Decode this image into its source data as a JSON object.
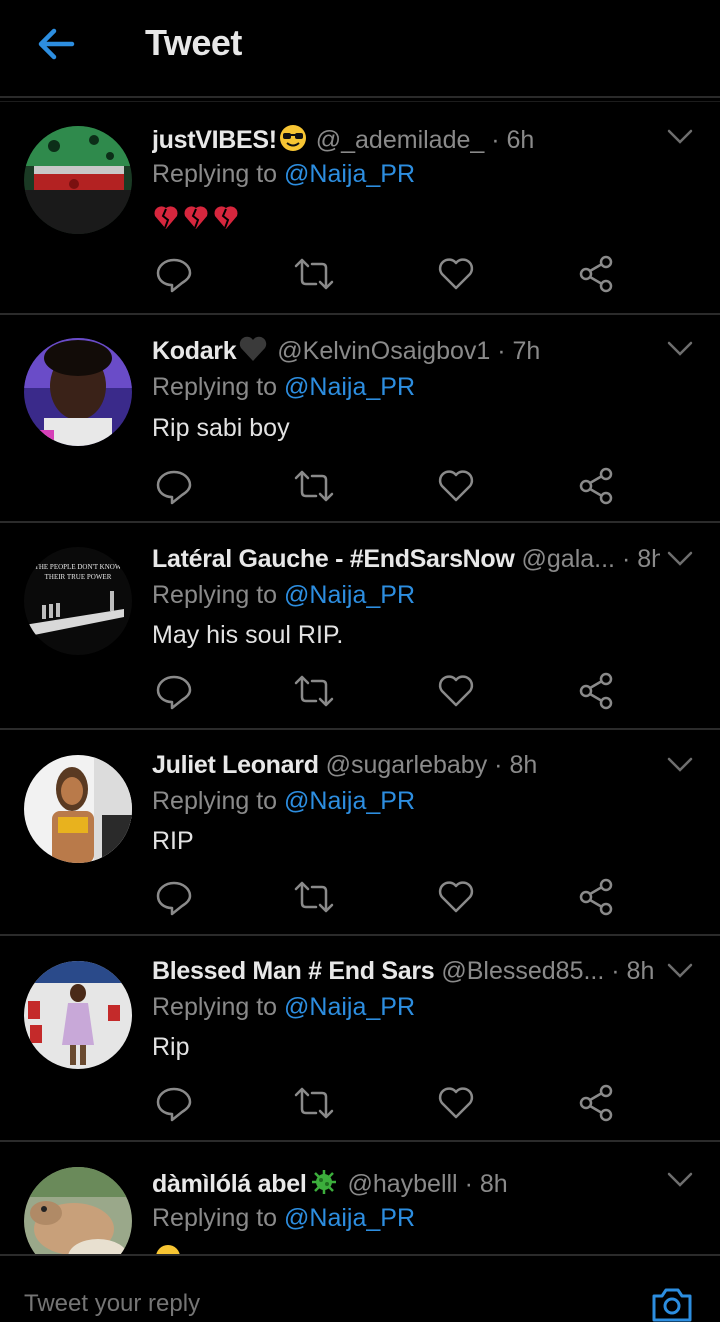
{
  "header": {
    "title": "Tweet"
  },
  "tweets": [
    {
      "name": "justVIBES!",
      "name_emoji": "sunglasses-emoji",
      "handle": "@_ademilade_",
      "time": "· 6h",
      "replying_prefix": "Replying to ",
      "replying_to": "@Naija_PR",
      "text": "",
      "body_emoji": "broken-heart-emoji x3"
    },
    {
      "name": "Kodark",
      "name_emoji": "black-heart-emoji",
      "handle": "@KelvinOsaigbov1",
      "time": "· 7h",
      "replying_prefix": "Replying to ",
      "replying_to": "@Naija_PR",
      "text": "Rip sabi boy"
    },
    {
      "name": "Latéral Gauche - #EndSarsNow",
      "handle": "@gala...",
      "time": "· 8h",
      "replying_prefix": "Replying to ",
      "replying_to": "@Naija_PR",
      "text": "May his soul RIP.",
      "avatar_text_1": "THE PEOPLE DON'T KNOW",
      "avatar_text_2": "THEIR TRUE POWER"
    },
    {
      "name": "Juliet Leonard",
      "handle": "@sugarlebaby",
      "time": "· 8h",
      "replying_prefix": "Replying to ",
      "replying_to": "@Naija_PR",
      "text": "RIP"
    },
    {
      "name": "Blessed Man # End Sars",
      "handle": "@Blessed85...",
      "time": "· 8h",
      "replying_prefix": "Replying to ",
      "replying_to": "@Naija_PR",
      "text": "Rip"
    },
    {
      "name": "dàmìlólá abel",
      "name_emoji": "virus-emoji",
      "handle": "@haybelll",
      "time": "· 8h",
      "replying_prefix": "Replying to ",
      "replying_to": "@Naija_PR",
      "text": ""
    }
  ],
  "reply_box": {
    "placeholder": "Tweet your reply"
  },
  "colors": {
    "background": "#000000",
    "accent": "#2d8ee0",
    "muted": "#8a8a8a",
    "divider": "#2b2b2b"
  },
  "icons": [
    "back-arrow-icon",
    "chevron-down-icon",
    "reply-icon",
    "retweet-icon",
    "like-icon",
    "share-icon",
    "camera-icon"
  ]
}
